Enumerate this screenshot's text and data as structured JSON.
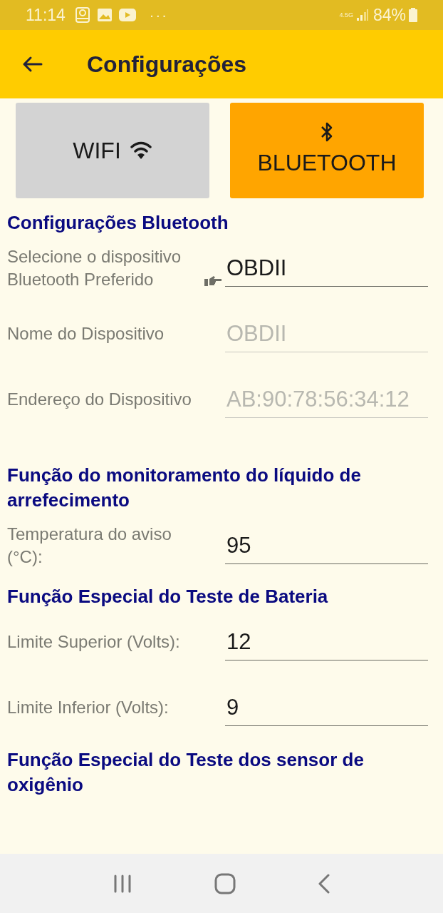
{
  "status_bar": {
    "time": "11:14",
    "more": "···",
    "network": "4.5G",
    "battery": "84%"
  },
  "app_bar": {
    "title": "Configurações"
  },
  "modes": [
    {
      "kind": "wifi",
      "label": "WIFI",
      "selected": false
    },
    {
      "kind": "bluetooth",
      "label": "BLUETOOTH",
      "selected": true
    }
  ],
  "sections": [
    {
      "title": "Configurações Bluetooth",
      "fields": [
        {
          "kind": "picker",
          "label": "Selecione o dispositivo Bluetooth Preferido",
          "value": "OBDII",
          "disabled": false
        },
        {
          "kind": "text",
          "label": "Nome do Dispositivo",
          "value": "OBDII",
          "disabled": true
        },
        {
          "kind": "text",
          "label": "Endereço do Dispositivo",
          "value": "AB:90:78:56:34:12",
          "disabled": true
        }
      ]
    },
    {
      "title": "Função do monitoramento do líquido de arrefecimento",
      "fields": [
        {
          "kind": "text",
          "label": "Temperatura do aviso (°C):",
          "value": "95",
          "disabled": false
        }
      ]
    },
    {
      "title": "Função Especial do Teste de Bateria",
      "fields": [
        {
          "kind": "text",
          "label": "Limite Superior (Volts):",
          "value": "12",
          "disabled": false
        },
        {
          "kind": "text",
          "label": "Limite Inferior (Volts):",
          "value": "9",
          "disabled": false
        }
      ]
    },
    {
      "title": "Função Especial do Teste dos sensor de oxigênio"
    }
  ]
}
